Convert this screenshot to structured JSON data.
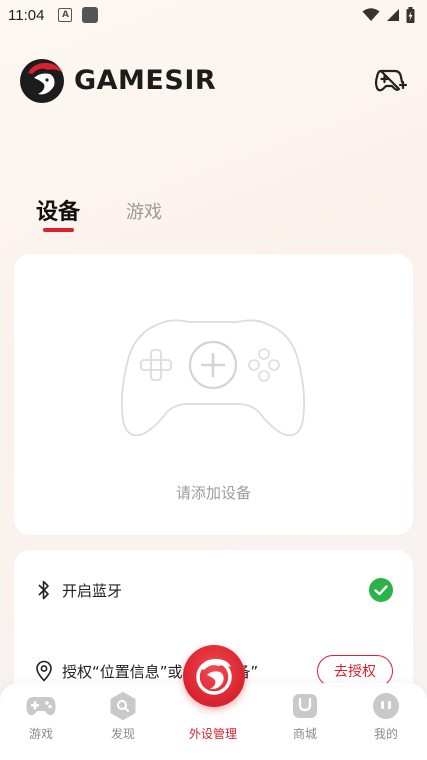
{
  "status_bar": {
    "time": "11:04",
    "a_badge": "A"
  },
  "header": {
    "brand": "GAMESIR",
    "add_game_icon": "gamepad-plus-icon"
  },
  "tabs": [
    {
      "label": "设备",
      "active": true
    },
    {
      "label": "游戏",
      "active": false
    }
  ],
  "device_card": {
    "placeholder": "请添加设备",
    "icon": "controller-add-icon"
  },
  "permissions": {
    "bluetooth_label": "开启蓝牙",
    "bluetooth_enabled": true,
    "location_label": "授权“位置信息”或“附近设备”",
    "authorize_button": "去授权"
  },
  "bottom_nav": [
    {
      "label": "游戏",
      "icon": "gamepad-icon",
      "active": false
    },
    {
      "label": "发现",
      "icon": "discover-icon",
      "active": false
    },
    {
      "label": "外设管理",
      "icon": "gamesir-logo-icon",
      "active": true
    },
    {
      "label": "商城",
      "icon": "shop-icon",
      "active": false
    },
    {
      "label": "我的",
      "icon": "profile-icon",
      "active": false
    }
  ],
  "colors": {
    "accent": "#d8222e",
    "check_green": "#2bb34a",
    "nav_icon_gray": "#c9c9c9"
  }
}
